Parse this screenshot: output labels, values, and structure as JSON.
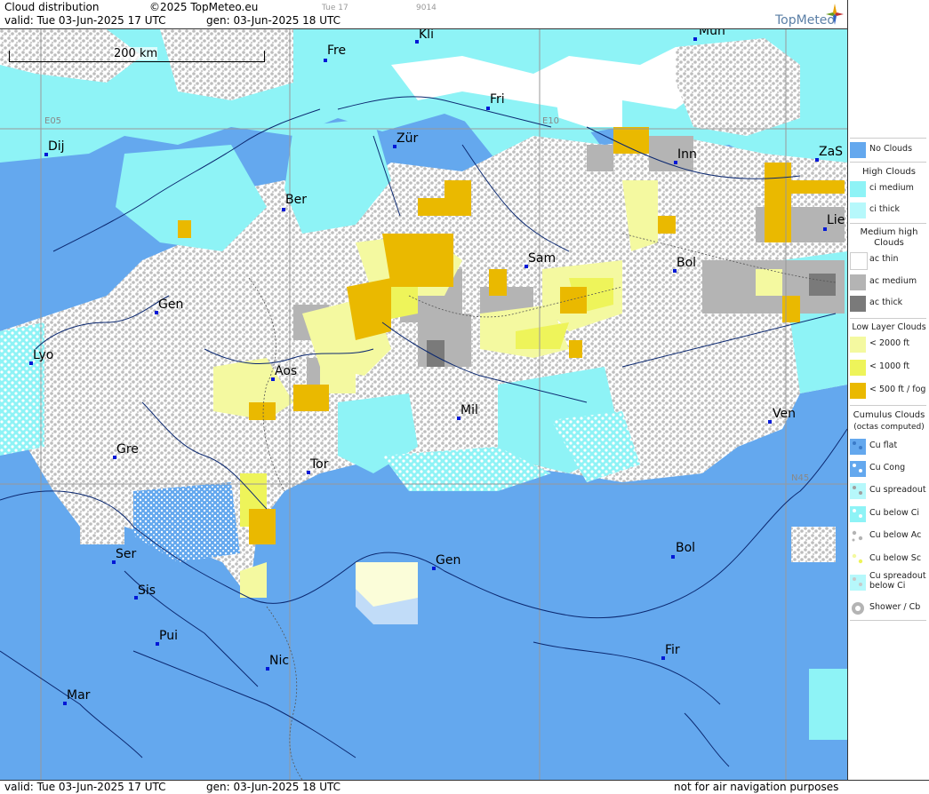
{
  "header": {
    "title": "Cloud distribution",
    "copyright": "©2025 TopMeteo.eu",
    "small_day": "Tue 17",
    "small_code": "9014",
    "valid": "valid:  Tue  03-Jun-2025  17 UTC",
    "gen": "gen: 03-Jun-2025 18 UTC",
    "brand": "TopMeteo"
  },
  "footer": {
    "valid": "valid:  Tue  03-Jun-2025  17 UTC",
    "gen": "gen: 03-Jun-2025 18 UTC",
    "note": "not for air navigation purposes"
  },
  "map": {
    "scale_label": "200 km",
    "grid_labels": {
      "e05": "E05",
      "e10": "E10",
      "n45": "N45"
    },
    "cities": [
      {
        "name": "Fre",
        "key": "fre"
      },
      {
        "name": "Kli",
        "key": "kli"
      },
      {
        "name": "Mün",
        "key": "mun"
      },
      {
        "name": "Fri",
        "key": "fri"
      },
      {
        "name": "Dij",
        "key": "dij"
      },
      {
        "name": "Zür",
        "key": "zur"
      },
      {
        "name": "Inn",
        "key": "inn"
      },
      {
        "name": "ZaS",
        "key": "zas"
      },
      {
        "name": "Ber",
        "key": "ber"
      },
      {
        "name": "Lie",
        "key": "lie"
      },
      {
        "name": "Sam",
        "key": "sam"
      },
      {
        "name": "Bol",
        "key": "bol1"
      },
      {
        "name": "Gen",
        "key": "gen1"
      },
      {
        "name": "Lyo",
        "key": "lyo"
      },
      {
        "name": "Aos",
        "key": "aos"
      },
      {
        "name": "Mil",
        "key": "mil"
      },
      {
        "name": "Ven",
        "key": "ven"
      },
      {
        "name": "Gre",
        "key": "gre"
      },
      {
        "name": "Tor",
        "key": "tor"
      },
      {
        "name": "Ser",
        "key": "ser"
      },
      {
        "name": "Gen",
        "key": "gen2"
      },
      {
        "name": "Bol",
        "key": "bol2"
      },
      {
        "name": "Sis",
        "key": "sis"
      },
      {
        "name": "Pui",
        "key": "pui"
      },
      {
        "name": "Nic",
        "key": "nic"
      },
      {
        "name": "Fir",
        "key": "fir"
      },
      {
        "name": "Mar",
        "key": "mar"
      }
    ]
  },
  "legend": {
    "no_clouds": "No Clouds",
    "high_clouds": "High Clouds",
    "ci_medium": "ci medium",
    "ci_thick": "ci thick",
    "medium_high": "Medium high Clouds",
    "ac_thin": "ac thin",
    "ac_medium": "ac medium",
    "ac_thick": "ac thick",
    "low_layer": "Low Layer Clouds",
    "lt2000": "< 2000 ft",
    "lt1000": "< 1000 ft",
    "lt500": "< 500 ft / fog",
    "cumulus": "Cumulus Clouds",
    "octas": "(octas computed)",
    "cu_flat": "Cu flat",
    "cu_cong": "Cu Cong",
    "cu_spreadout": "Cu spreadout",
    "cu_below_ci": "Cu below Ci",
    "cu_below_ac": "Cu below Ac",
    "cu_below_sc": "Cu below Sc",
    "cu_spreadout_below_ci": "Cu spreadout below Ci",
    "shower_cb": "Shower / Cb"
  },
  "colors": {
    "sea_clear": "#64a8ee",
    "ci": "#8ef3f6",
    "ci_thick": "#b6f8fb",
    "ac_medium": "#b4b4b4",
    "ac_thick": "#7a7a7a",
    "low_2000": "#f4f9a0",
    "low_1000": "#eef45a",
    "low_500": "#eab900"
  }
}
